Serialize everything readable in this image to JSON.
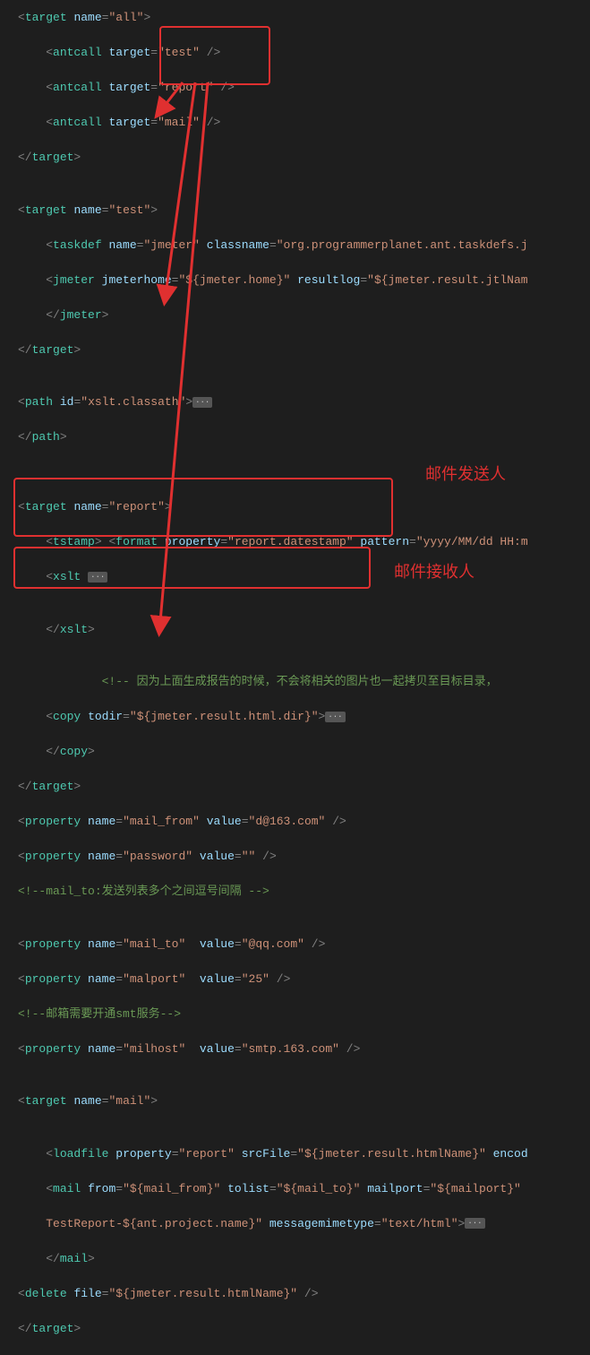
{
  "code": {
    "l1": {
      "tag": "target",
      "a1": "name",
      "v1": "\"all\"",
      "close": ">"
    },
    "l2": {
      "tag": "antcall",
      "a1": "target",
      "v1": "\"test\"",
      "close": "/>"
    },
    "l3": {
      "tag": "antcall",
      "a1": "target",
      "v1": "\"report\"",
      "close": "/>"
    },
    "l4": {
      "tag": "antcall",
      "a1": "target",
      "v1": "\"mail\"",
      "close": "/>"
    },
    "l5": {
      "tag": "target"
    },
    "l6": {
      "tag": "target",
      "a1": "name",
      "v1": "\"test\"",
      "close": ">"
    },
    "l7": {
      "tag": "taskdef",
      "a1": "name",
      "v1": "\"jmeter\"",
      "a2": "classname",
      "v2": "\"org.programmerplanet.ant.taskdefs.j"
    },
    "l8": {
      "tag": "jmeter",
      "a1": "jmeterhome",
      "v1": "\"${jmeter.home}\"",
      "a2": "resultlog",
      "v2": "\"${jmeter.result.jtlNam"
    },
    "l9": {
      "tag": "jmeter"
    },
    "l10": {
      "tag": "target"
    },
    "l11": {
      "tag": "path",
      "a1": "id",
      "v1": "\"xslt.class",
      "v1b": "ath\"",
      "close": ">"
    },
    "l12": {
      "tag": "path"
    },
    "l13": {
      "tag": "target",
      "a1": "name",
      "v1": "\"report\"",
      "close": ">"
    },
    "l14": {
      "tag": "tstamp",
      "tag2": "format",
      "a1": "property",
      "v1": "\"report.datestamp\"",
      "a2": "pattern",
      "v2": "\"yyyy/MM/dd HH:m"
    },
    "l15": {
      "tag": "xslt"
    },
    "l16": {
      "tag": "xslt"
    },
    "l17": {
      "comment": "<!-- 因为上面生成报告的时候，不会将相关的图片也一起拷贝至目标目录，"
    },
    "l18": {
      "tag": "copy",
      "a1": "todir",
      "v1": "\"${jmeter.result.html.dir}\"",
      "close": ">"
    },
    "l19": {
      "tag": "copy"
    },
    "l20": {
      "tag": "target"
    },
    "l21": {
      "tag": "property",
      "a1": "name",
      "v1": "\"mail_from\"",
      "a2": "value",
      "v2": "\"d@163.com\"",
      "close": "/>"
    },
    "l22": {
      "tag": "property",
      "a1": "name",
      "v1": "\"password\"",
      "a2": "value",
      "v2": "\"\"",
      "close": "/>"
    },
    "l23": {
      "comment": "<!--mail_to:发送列表",
      "comment_b": "多个之间逗号间隔 -->"
    },
    "l24": {
      "tag": "property",
      "a1": "name",
      "v1": "\"mail_to\"",
      "a2": "value",
      "v2": "\"@qq.com\"",
      "close": "/>"
    },
    "l25": {
      "tag": "property",
      "a1": "name",
      "v1": "\"ma",
      "v1b": "lport\"",
      "a2": "value",
      "v2": "\"25\"",
      "close": "/>"
    },
    "l26": {
      "comment": "<!--邮箱需要开通smt",
      "comment_b": "服务-->"
    },
    "l27": {
      "tag": "property",
      "a1": "name",
      "v1": "\"m",
      "v1b": "ilhost\"",
      "a2": "value",
      "v2": "\"smtp.163.com\"",
      "close": "/>"
    },
    "l28": {
      "tag": "target",
      "a1": "name",
      "v1": "\"mail\"",
      "close": ">"
    },
    "l29": {
      "tag": "loadfile",
      "a1": "property",
      "v1": "\"report\"",
      "a2": "srcFile",
      "v2": "\"${jmeter.result.htmlName}\"",
      "a3": "encod"
    },
    "l30": {
      "tag": "mail",
      "a1": "from",
      "v1": "\"${mail_from}\"",
      "a2": "tolist",
      "v2": "\"${mail_to}\"",
      "a3": "mailport",
      "v3": "\"${mailport}\""
    },
    "l31": {
      "text": "TestReport-${ant.project.name}\"",
      "a1": "messagemimetype",
      "v1": "\"text/html\"",
      "close": ">"
    },
    "l32": {
      "tag": "mail"
    },
    "l33": {
      "tag": "delete",
      "a1": "file",
      "v1": "\"${jmeter.result.htmlName}\"",
      "close": "/>"
    },
    "l34": {
      "tag": "target"
    }
  },
  "labels": {
    "sender": "邮件发送人",
    "recipient": "邮件接收人"
  },
  "fold": "···"
}
